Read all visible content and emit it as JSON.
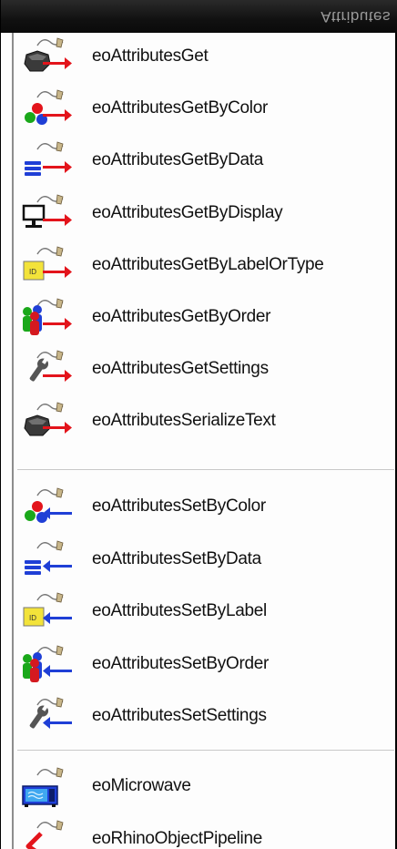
{
  "panel": {
    "title": "Attributes"
  },
  "get_items": [
    {
      "label": "eoAttributesGet",
      "icon": "grey-block-icon",
      "dir": "get"
    },
    {
      "label": "eoAttributesGetByColor",
      "icon": "color-dots-icon",
      "dir": "get"
    },
    {
      "label": "eoAttributesGetByData",
      "icon": "data-stack-icon",
      "dir": "get"
    },
    {
      "label": "eoAttributesGetByDisplay",
      "icon": "display-monitor-icon",
      "dir": "get"
    },
    {
      "label": "eoAttributesGetByLabelOrType",
      "icon": "id-label-icon",
      "dir": "get"
    },
    {
      "label": "eoAttributesGetByOrder",
      "icon": "people-icon",
      "dir": "get"
    },
    {
      "label": "eoAttributesGetSettings",
      "icon": "wrench-icon",
      "dir": "get"
    },
    {
      "label": "eoAttributesSerializeText",
      "icon": "grey-block-icon",
      "dir": "get"
    }
  ],
  "set_items": [
    {
      "label": "eoAttributesSetByColor",
      "icon": "color-dots-icon",
      "dir": "set"
    },
    {
      "label": "eoAttributesSetByData",
      "icon": "data-stack-icon",
      "dir": "set"
    },
    {
      "label": "eoAttributesSetByLabel",
      "icon": "id-label-icon",
      "dir": "set"
    },
    {
      "label": "eoAttributesSetByOrder",
      "icon": "people-icon",
      "dir": "set"
    },
    {
      "label": "eoAttributesSetSettings",
      "icon": "wrench-icon",
      "dir": "set"
    }
  ],
  "misc_items": [
    {
      "label": "eoMicrowave",
      "icon": "microwave-icon",
      "dir": "none"
    },
    {
      "label": "eoRhinoObjectPipeline",
      "icon": "pipeline-icon",
      "dir": "none"
    }
  ],
  "colors": {
    "get_arrow": "#e3141b",
    "set_arrow": "#1f3fd6",
    "id_label": "#f3e33a"
  }
}
